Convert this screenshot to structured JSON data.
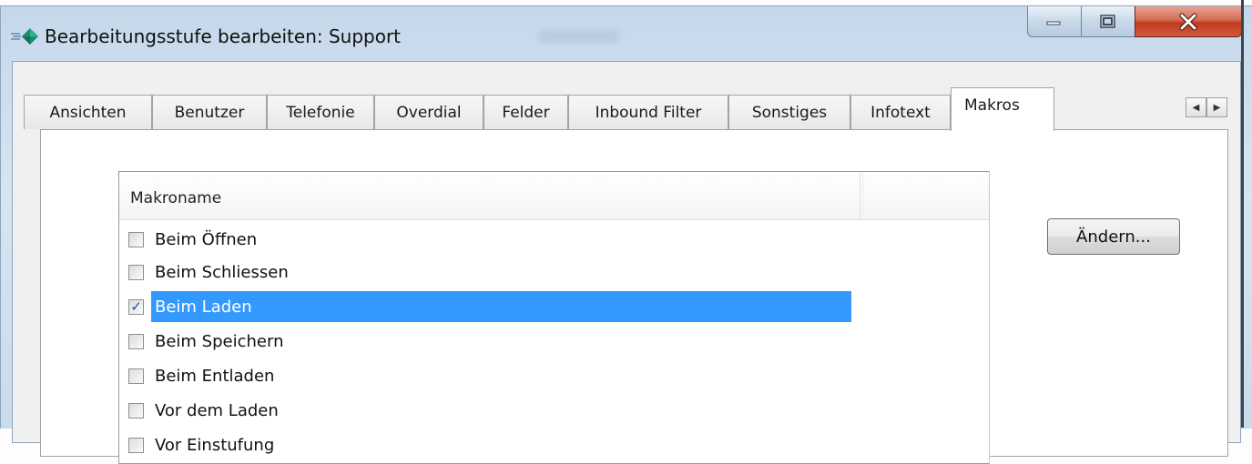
{
  "window": {
    "title": "Bearbeitungsstufe bearbeiten: Support",
    "controls": {
      "minimize": "minimize",
      "maximize": "maximize",
      "close": "close"
    }
  },
  "tabs": [
    {
      "label": "Ansichten",
      "active": false
    },
    {
      "label": "Benutzer",
      "active": false
    },
    {
      "label": "Telefonie",
      "active": false
    },
    {
      "label": "Overdial",
      "active": false
    },
    {
      "label": "Felder",
      "active": false
    },
    {
      "label": "Inbound Filter",
      "active": false
    },
    {
      "label": "Sonstiges",
      "active": false
    },
    {
      "label": "Infotext",
      "active": false
    },
    {
      "label": "Makros",
      "active": true
    }
  ],
  "list": {
    "column_header": "Makroname",
    "rows": [
      {
        "label": "Beim Öffnen",
        "checked": false,
        "selected": false
      },
      {
        "label": "Beim Schliessen",
        "checked": false,
        "selected": false
      },
      {
        "label": "Beim Laden",
        "checked": true,
        "selected": true
      },
      {
        "label": "Beim Speichern",
        "checked": false,
        "selected": false
      },
      {
        "label": "Beim Entladen",
        "checked": false,
        "selected": false
      },
      {
        "label": "Vor dem Laden",
        "checked": false,
        "selected": false
      },
      {
        "label": "Vor Einstufung",
        "checked": false,
        "selected": false
      }
    ]
  },
  "buttons": {
    "change_label": "Ändern..."
  },
  "colors": {
    "selection": "#3399ff",
    "close_button": "#c7432a",
    "check_mark": "#1b4f9e"
  }
}
